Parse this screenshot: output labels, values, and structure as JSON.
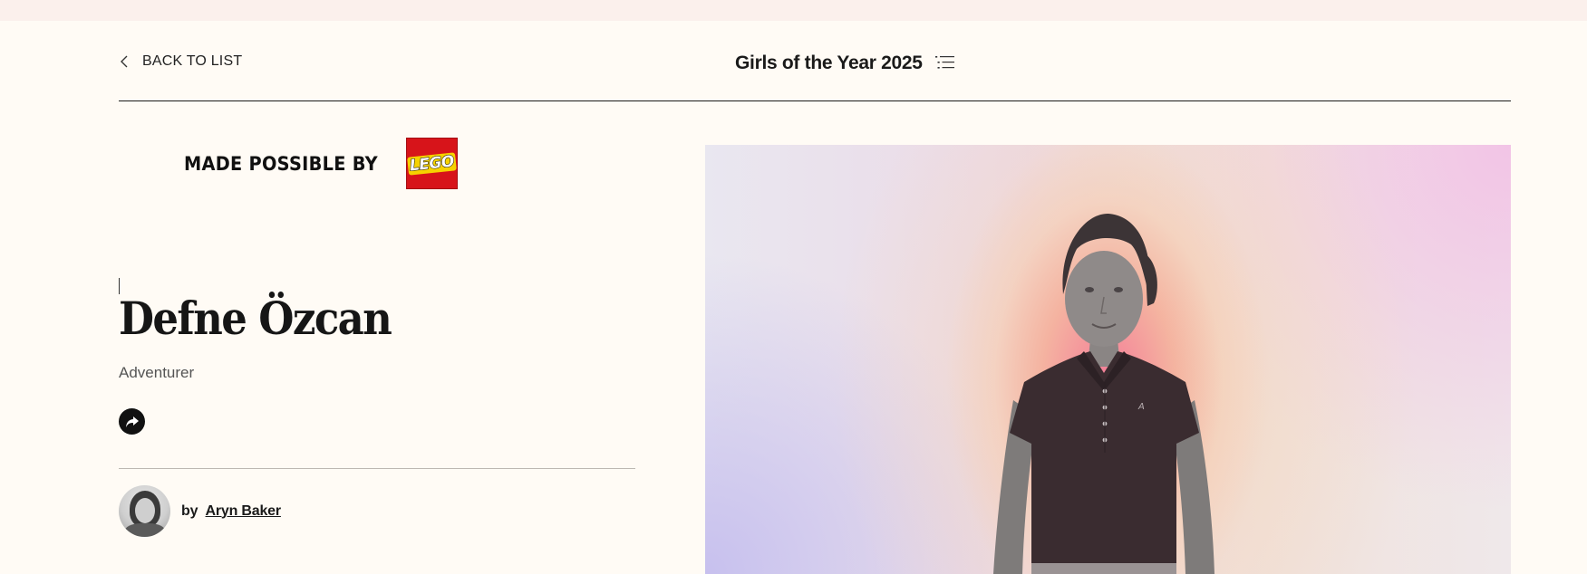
{
  "nav": {
    "back_label": "BACK TO LIST",
    "list_title": "Girls of the Year 2025"
  },
  "sponsor": {
    "label": "MADE POSSIBLE BY",
    "logo_text": "LEGO",
    "logo_color": "#d7141a"
  },
  "profile": {
    "name": "Defne Özcan",
    "role": "Adventurer",
    "share_icon": "share-arrow-icon"
  },
  "author": {
    "prefix": "by",
    "name": "Aryn Baker"
  },
  "hero": {
    "shirt_logo": "A"
  },
  "colors": {
    "background": "#fffbf5",
    "top_strip": "#fbf0ec",
    "text": "#1a1a1a",
    "muted": "#555555"
  }
}
